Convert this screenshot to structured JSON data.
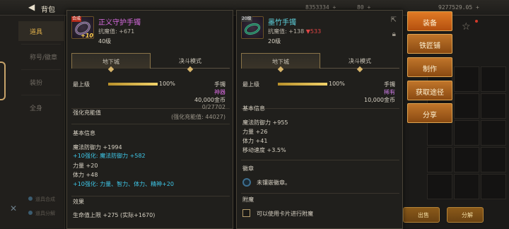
{
  "background": {
    "title": "背包",
    "currency": [
      "8353334 +",
      "80 +",
      "9277529.05 +"
    ],
    "sidebar_tabs": [
      "道具",
      "称号/徽章",
      "装扮",
      "全身"
    ],
    "sidebar_bottom": [
      "道具合成",
      "道具分解"
    ],
    "bottom_buttons": [
      "出售",
      "分解"
    ]
  },
  "left_item": {
    "name": "正义守护手镯",
    "name_color": "#d86be0",
    "icon_badge": "合成",
    "icon_plus": "+10",
    "stat": "抗魔值: +671",
    "level": "40级",
    "tabs": [
      "地下城",
      "决斗模式"
    ],
    "mastery_label": "最上级",
    "mastery_pct": "100%",
    "mastery_value": 1.0,
    "category": "手镯",
    "rarity": "神器",
    "rarity_color": "#d86be0",
    "price": "40,000金币",
    "reinforce_label": "强化充能值",
    "reinforce_value": "0/27702",
    "reinforce_sub": "(强化充能值: 44027)",
    "basic_title": "基本信息",
    "basic_lines": [
      {
        "text": "魔法防御力 +1994",
        "cyan": false
      },
      {
        "text": "+10强化:  魔法防御力 +582",
        "cyan": true
      },
      {
        "text": "力量 +20",
        "cyan": false
      },
      {
        "text": "体力 +48",
        "cyan": false
      },
      {
        "text": "+10强化:  力量、智力、体力、精神+20",
        "cyan": true
      }
    ],
    "effect_title": "效果",
    "effect_line": "生命值上限 +275 (实际+1670)"
  },
  "right_item": {
    "name": "墨竹手镯",
    "name_color": "#5fd4e0",
    "icon_badge": "20级",
    "stat": "抗魔值: +138",
    "stat_diff": "▼533",
    "level": "20级",
    "tabs": [
      "地下城",
      "决斗模式"
    ],
    "mastery_label": "最上级",
    "mastery_pct": "100%",
    "mastery_value": 1.0,
    "category": "手镯",
    "rarity": "稀有",
    "rarity_color": "#c87ae0",
    "price": "10,000金币",
    "basic_title": "基本信息",
    "basic_lines": [
      "魔法防御力 +955",
      "力量 +26",
      "体力 +41",
      "移动速度 +3.5%"
    ],
    "emblem_title": "徽章",
    "emblem_text": "未镶嵌徽章。",
    "enchant_title": "附魔",
    "enchant_text": "可以使用卡片进行附魔"
  },
  "actions": [
    "装备",
    "铁匠铺",
    "制作",
    "获取途径",
    "分享"
  ]
}
